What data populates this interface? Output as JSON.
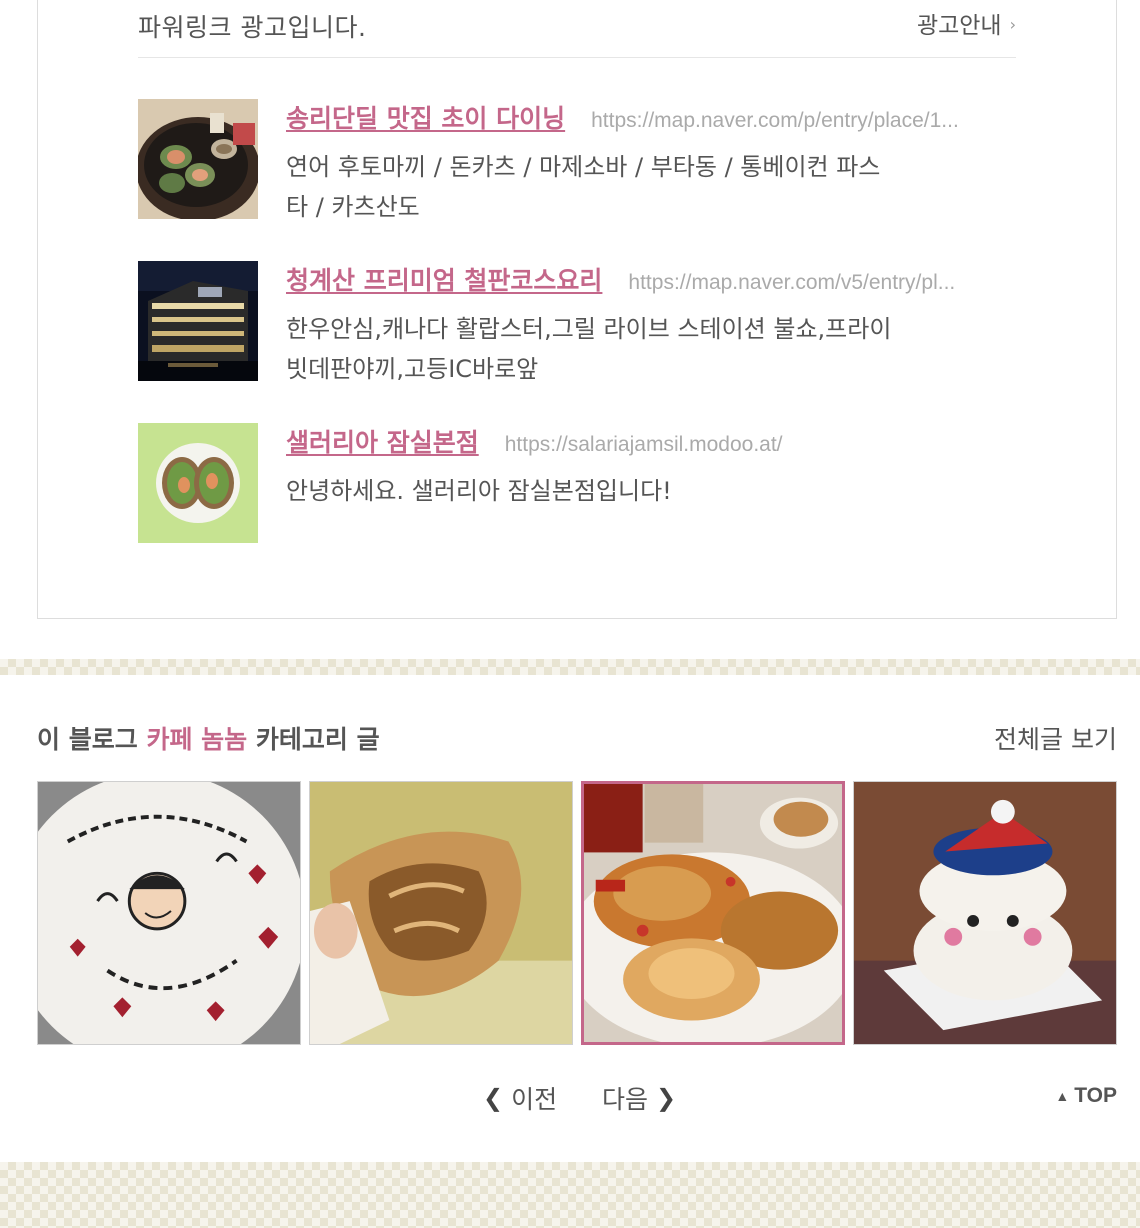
{
  "ad_section": {
    "title": "파워링크 광고입니다.",
    "info_label": "광고안내",
    "items": [
      {
        "name": "송리단딜 맛집 초이 다이닝",
        "url": "https://map.naver.com/p/entry/place/1...",
        "description": "연어 후토마끼 / 돈카츠 / 마제소바 / 부타동 / 통베이컨 파스타 / 카츠산도"
      },
      {
        "name": "청계산 프리미엄 철판코스요리",
        "url": "https://map.naver.com/v5/entry/pl...",
        "description": "한우안심,캐나다 활랍스터,그릴 라이브 스테이션 불쇼,프라이빗데판야끼,고등IC바로앞"
      },
      {
        "name": "샐러리아 잠실본점",
        "url": "https://salariajamsil.modoo.at/",
        "description": "안녕하세요. 샐러리아 잠실본점입니다!"
      }
    ]
  },
  "category_section": {
    "title_prefix": "이 블로그",
    "category_name": "카페 놈놈",
    "title_suffix": "카테고리 글",
    "view_all_label": "전체글 보기",
    "thumbnails": [
      {
        "label": "thumbnail-cake-lettering",
        "selected": false
      },
      {
        "label": "thumbnail-pastry-in-hand",
        "selected": false
      },
      {
        "label": "thumbnail-bread-plate",
        "selected": true
      },
      {
        "label": "thumbnail-santa-cake",
        "selected": false
      }
    ]
  },
  "pagination": {
    "prev_label": "이전",
    "next_label": "다음",
    "top_label": "TOP"
  },
  "colors": {
    "accent": "#c4678a",
    "text": "#555555",
    "url": "#aaaaaa"
  }
}
